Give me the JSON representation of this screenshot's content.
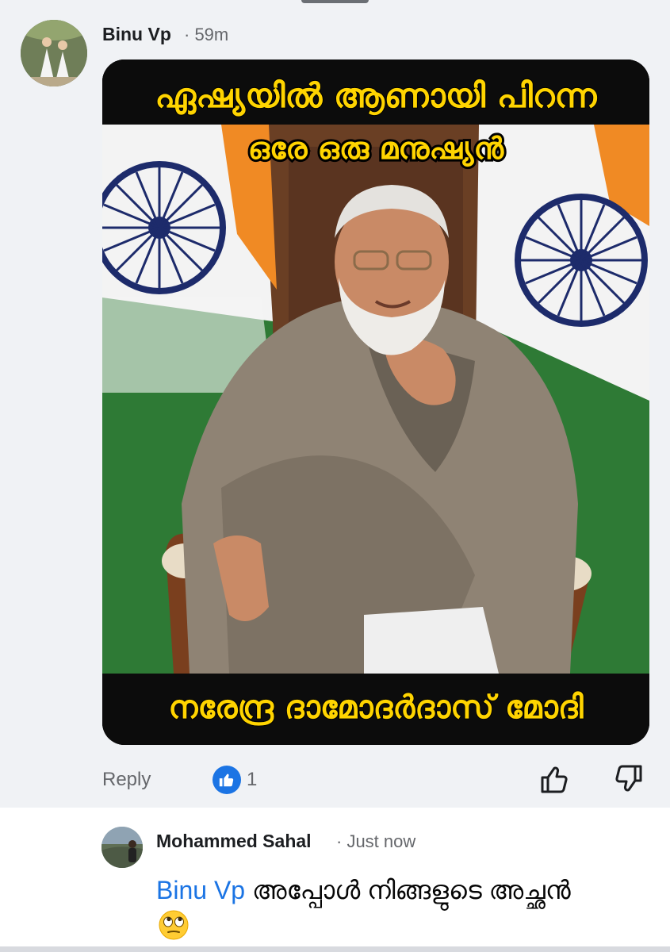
{
  "comment": {
    "author": "Binu Vp",
    "time": "· 59m",
    "image": {
      "caption_top_line1": "ഏഷ്യയിൽ ആണായി പിറന്ന",
      "caption_top_line2": "ഒരേ ഒരു മനുഷ്യൻ",
      "caption_bottom": "നരേന്ദ്ര ദാമോദർദാസ് മോദി"
    },
    "actions": {
      "reply_label": "Reply",
      "like_count": "1"
    }
  },
  "reply": {
    "author": "Mohammed Sahal",
    "time": "· Just now",
    "mention": "Binu Vp",
    "text": " അപ്പോൾ നിങ്ങളുടെ അച്ഛൻ",
    "emoji": "face-with-rolling-eyes"
  },
  "colors": {
    "background": "#f0f2f5",
    "accent": "#1b74e4",
    "caption_text": "#ffd400",
    "secondary_text": "#65676b"
  }
}
